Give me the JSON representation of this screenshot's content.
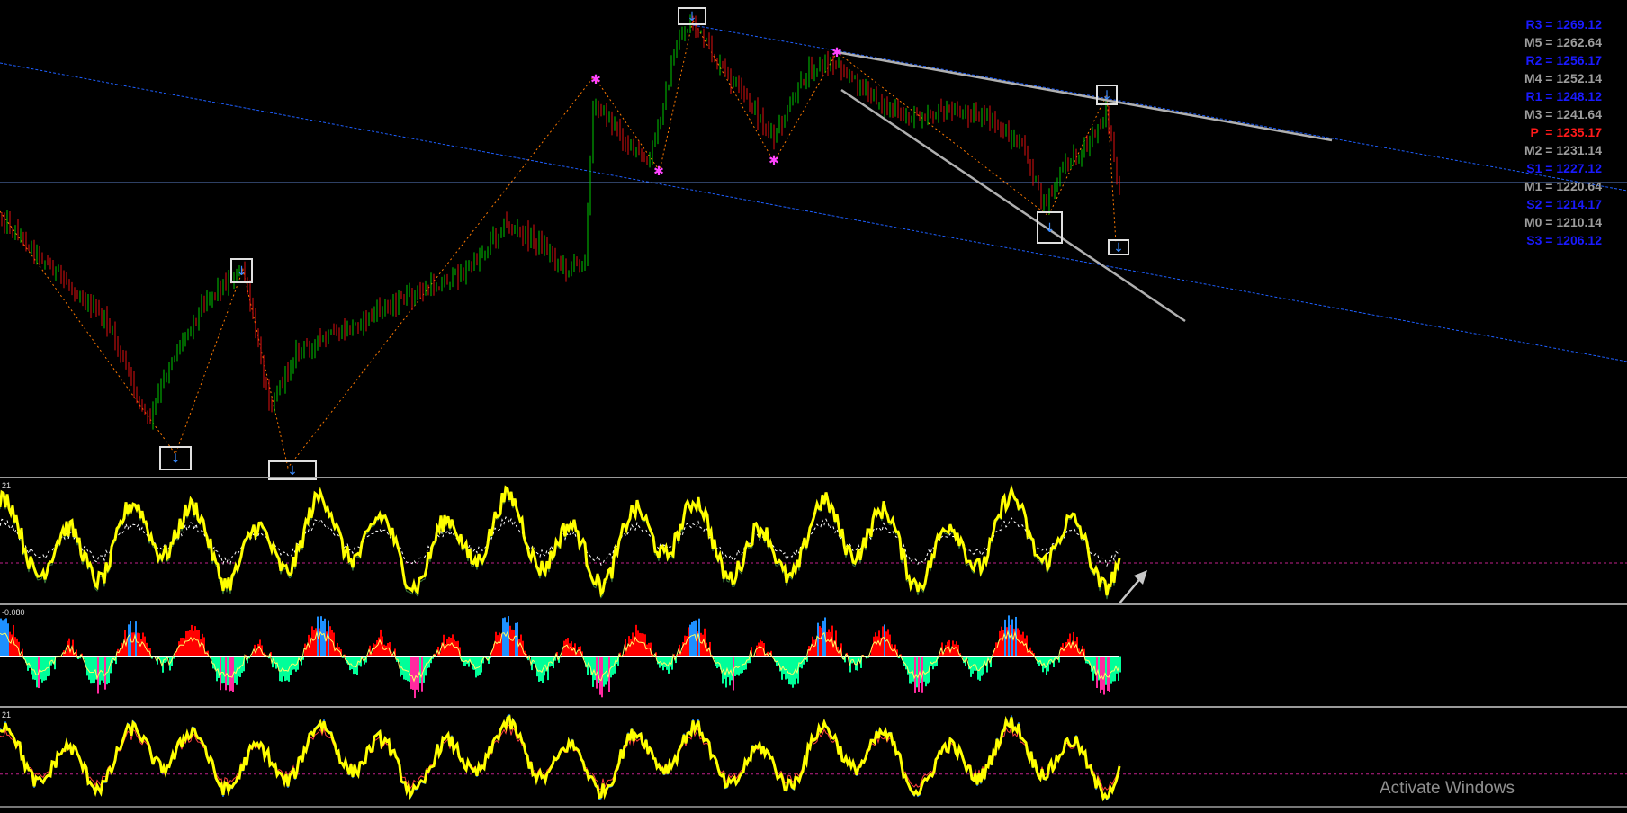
{
  "chart_data": [
    {
      "type": "line",
      "name": "price-panel",
      "pivot_levels": [
        {
          "label": "R3",
          "value": "1269.12",
          "color": "#1a1aff"
        },
        {
          "label": "M5",
          "value": "1262.64",
          "color": "#9c9c9c"
        },
        {
          "label": "R2",
          "value": "1256.17",
          "color": "#1a1aff"
        },
        {
          "label": "M4",
          "value": "1252.14",
          "color": "#9c9c9c"
        },
        {
          "label": "R1",
          "value": "1248.12",
          "color": "#1a1aff"
        },
        {
          "label": "M3",
          "value": "1241.64",
          "color": "#9c9c9c"
        },
        {
          "label": "P ",
          "value": "1235.17",
          "color": "#ff1a1a"
        },
        {
          "label": "M2",
          "value": "1231.14",
          "color": "#9c9c9c"
        },
        {
          "label": "S1",
          "value": "1227.12",
          "color": "#1a1aff"
        },
        {
          "label": "M1",
          "value": "1220.64",
          "color": "#9c9c9c"
        },
        {
          "label": "S2",
          "value": "1214.17",
          "color": "#1a1aff"
        },
        {
          "label": "M0",
          "value": "1210.14",
          "color": "#9c9c9c"
        },
        {
          "label": "S3",
          "value": "1206.12",
          "color": "#1a1aff"
        }
      ],
      "colors": {
        "bull": "#00c800",
        "bear": "#e01010",
        "zigzag": "#ff7a00",
        "trend": "#1e5fff",
        "channel": "#b0b0b0"
      }
    },
    {
      "type": "line",
      "name": "oscillator-1",
      "label": "21",
      "colors": {
        "main": "#ffff00",
        "signal": "#ffffff",
        "aux": "#3a7a3a",
        "level": "#c0208a"
      }
    },
    {
      "type": "area",
      "name": "oscillator-2",
      "label": "-0.080",
      "colors": {
        "pos": "#ff0000",
        "neg": "#00ff99",
        "posExt": "#1e90ff",
        "negExt": "#ff2aa0",
        "line": "#ffff66"
      }
    },
    {
      "type": "line",
      "name": "oscillator-3",
      "label": "21",
      "colors": {
        "main": "#ffff00",
        "fast": "#1e90ff",
        "slow": "#ff4040",
        "level": "#c0208a"
      }
    }
  ],
  "watermark": {
    "text": "Activate Windows"
  }
}
